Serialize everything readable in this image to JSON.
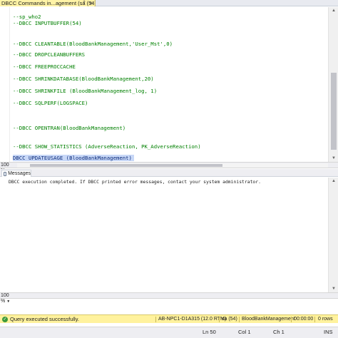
{
  "document_tab": {
    "title": "DBCC Commands in...agement (sa (54))*",
    "pin_glyph": "†",
    "close_glyph": "×"
  },
  "editor": {
    "lines": [
      "--sp_who2",
      "--DBCC INPUTBUFFER(54)",
      "--DBCC CLEANTABLE(BloodBankManagement,'User_Mst',0)",
      "--DBCC DROPCLEANBUFFERS",
      "--DBCC FREEPROCCACHE",
      "--DBCC SHRINKDATABASE(BloodBankManagement,20)",
      "--DBCC SHRINKFILE (BloodBankManagement_log, 1)",
      "--DBCC SQLPERF(LOGSPACE)",
      "--DBCC OPENTRAN(BloodBankManagement)",
      "--DBCC SHOW_STATISTICS (AdverseReaction, PK_AdverseReaction)",
      "DBCC UPDATEUSAGE (BloodBankManagement)"
    ],
    "zoom": "100 %"
  },
  "results": {
    "tab_label": "Messages",
    "message": "DBCC execution completed. If DBCC printed error messages, contact your system administrator.",
    "zoom": "100 %"
  },
  "status_bar": {
    "message": "Query executed successfully.",
    "server": "AB-NPC1-D1A315 (12.0 RTM)",
    "user": "sa (54)",
    "database": "BloodBankManagement",
    "elapsed": "00:00:00",
    "rows": "0 rows"
  },
  "ide_status": {
    "line": "Ln 50",
    "column": "Col 1",
    "char": "Ch 1",
    "mode": "INS"
  },
  "colors": {
    "comment": "#008000",
    "selection": "#c8d8f7",
    "status_bar": "#fff29d",
    "success_icon": "#3c9a3a"
  },
  "icons": {
    "status": "check-circle-icon",
    "messages_tab": "message-icon"
  }
}
